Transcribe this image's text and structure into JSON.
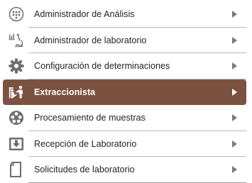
{
  "menu": {
    "items": [
      {
        "label": "Administrador de Análisis",
        "icon": "dotted-circle-icon"
      },
      {
        "label": "Administrador de laboratorio",
        "icon": "microscope-icon"
      },
      {
        "label": "Configuración de determinaciones",
        "icon": "gear-icon"
      },
      {
        "label": "Extraccionista",
        "icon": "extraction-icon",
        "active": true
      },
      {
        "label": "Procesamiento de muestras",
        "icon": "processing-icon"
      },
      {
        "label": "Recepción de Laboratorio",
        "icon": "inbox-download-icon"
      },
      {
        "label": "Solicitudes de laboratorio",
        "icon": "document-icon"
      }
    ]
  },
  "colors": {
    "active_bg": "#7b5140",
    "icon_gray": "#6e6e6e",
    "separator": "#b9b9b9"
  }
}
